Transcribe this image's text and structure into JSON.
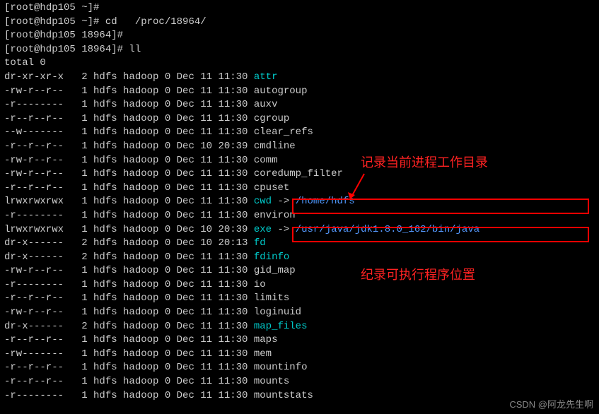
{
  "prompts": [
    {
      "user": "root",
      "host": "hdp105",
      "cwd": "~",
      "cmd_pre": "",
      "cmd": "",
      "tail": ""
    },
    {
      "user": "root",
      "host": "hdp105",
      "cwd": "~",
      "cmd_pre": "cd   ",
      "cmd": "/proc/18964/",
      "tail": ""
    },
    {
      "user": "root",
      "host": "hdp105",
      "cwd": "18964",
      "cmd_pre": "",
      "cmd": "",
      "tail": ""
    },
    {
      "user": "root",
      "host": "hdp105",
      "cwd": "18964",
      "cmd_pre": "ll",
      "cmd": "",
      "tail": ""
    }
  ],
  "total_line": "total 0",
  "rows": [
    {
      "perm": "dr-xr-xr-x",
      "n": "2",
      "u": "hdfs",
      "g": "hadoop",
      "s": "0",
      "mo": "Dec",
      "d": "11",
      "t": "11:30",
      "name": "attr",
      "link": "",
      "color": "cyan"
    },
    {
      "perm": "-rw-r--r--",
      "n": "1",
      "u": "hdfs",
      "g": "hadoop",
      "s": "0",
      "mo": "Dec",
      "d": "11",
      "t": "11:30",
      "name": "autogroup",
      "link": "",
      "color": ""
    },
    {
      "perm": "-r--------",
      "n": "1",
      "u": "hdfs",
      "g": "hadoop",
      "s": "0",
      "mo": "Dec",
      "d": "11",
      "t": "11:30",
      "name": "auxv",
      "link": "",
      "color": ""
    },
    {
      "perm": "-r--r--r--",
      "n": "1",
      "u": "hdfs",
      "g": "hadoop",
      "s": "0",
      "mo": "Dec",
      "d": "11",
      "t": "11:30",
      "name": "cgroup",
      "link": "",
      "color": ""
    },
    {
      "perm": "--w-------",
      "n": "1",
      "u": "hdfs",
      "g": "hadoop",
      "s": "0",
      "mo": "Dec",
      "d": "11",
      "t": "11:30",
      "name": "clear_refs",
      "link": "",
      "color": ""
    },
    {
      "perm": "-r--r--r--",
      "n": "1",
      "u": "hdfs",
      "g": "hadoop",
      "s": "0",
      "mo": "Dec",
      "d": "10",
      "t": "20:39",
      "name": "cmdline",
      "link": "",
      "color": ""
    },
    {
      "perm": "-rw-r--r--",
      "n": "1",
      "u": "hdfs",
      "g": "hadoop",
      "s": "0",
      "mo": "Dec",
      "d": "11",
      "t": "11:30",
      "name": "comm",
      "link": "",
      "color": ""
    },
    {
      "perm": "-rw-r--r--",
      "n": "1",
      "u": "hdfs",
      "g": "hadoop",
      "s": "0",
      "mo": "Dec",
      "d": "11",
      "t": "11:30",
      "name": "coredump_filter",
      "link": "",
      "color": ""
    },
    {
      "perm": "-r--r--r--",
      "n": "1",
      "u": "hdfs",
      "g": "hadoop",
      "s": "0",
      "mo": "Dec",
      "d": "11",
      "t": "11:30",
      "name": "cpuset",
      "link": "",
      "color": ""
    },
    {
      "perm": "lrwxrwxrwx",
      "n": "1",
      "u": "hdfs",
      "g": "hadoop",
      "s": "0",
      "mo": "Dec",
      "d": "11",
      "t": "11:30",
      "name": "cwd",
      "link": "/home/hdfs",
      "color": "cyan"
    },
    {
      "perm": "-r--------",
      "n": "1",
      "u": "hdfs",
      "g": "hadoop",
      "s": "0",
      "mo": "Dec",
      "d": "11",
      "t": "11:30",
      "name": "environ",
      "link": "",
      "color": ""
    },
    {
      "perm": "lrwxrwxrwx",
      "n": "1",
      "u": "hdfs",
      "g": "hadoop",
      "s": "0",
      "mo": "Dec",
      "d": "10",
      "t": "20:39",
      "name": "exe",
      "link": "/usr/java/jdk1.8.0_162/bin/java",
      "color": "cyan"
    },
    {
      "perm": "dr-x------",
      "n": "2",
      "u": "hdfs",
      "g": "hadoop",
      "s": "0",
      "mo": "Dec",
      "d": "10",
      "t": "20:13",
      "name": "fd",
      "link": "",
      "color": "cyan"
    },
    {
      "perm": "dr-x------",
      "n": "2",
      "u": "hdfs",
      "g": "hadoop",
      "s": "0",
      "mo": "Dec",
      "d": "11",
      "t": "11:30",
      "name": "fdinfo",
      "link": "",
      "color": "cyan"
    },
    {
      "perm": "-rw-r--r--",
      "n": "1",
      "u": "hdfs",
      "g": "hadoop",
      "s": "0",
      "mo": "Dec",
      "d": "11",
      "t": "11:30",
      "name": "gid_map",
      "link": "",
      "color": ""
    },
    {
      "perm": "-r--------",
      "n": "1",
      "u": "hdfs",
      "g": "hadoop",
      "s": "0",
      "mo": "Dec",
      "d": "11",
      "t": "11:30",
      "name": "io",
      "link": "",
      "color": ""
    },
    {
      "perm": "-r--r--r--",
      "n": "1",
      "u": "hdfs",
      "g": "hadoop",
      "s": "0",
      "mo": "Dec",
      "d": "11",
      "t": "11:30",
      "name": "limits",
      "link": "",
      "color": ""
    },
    {
      "perm": "-rw-r--r--",
      "n": "1",
      "u": "hdfs",
      "g": "hadoop",
      "s": "0",
      "mo": "Dec",
      "d": "11",
      "t": "11:30",
      "name": "loginuid",
      "link": "",
      "color": ""
    },
    {
      "perm": "dr-x------",
      "n": "2",
      "u": "hdfs",
      "g": "hadoop",
      "s": "0",
      "mo": "Dec",
      "d": "11",
      "t": "11:30",
      "name": "map_files",
      "link": "",
      "color": "cyan"
    },
    {
      "perm": "-r--r--r--",
      "n": "1",
      "u": "hdfs",
      "g": "hadoop",
      "s": "0",
      "mo": "Dec",
      "d": "11",
      "t": "11:30",
      "name": "maps",
      "link": "",
      "color": ""
    },
    {
      "perm": "-rw-------",
      "n": "1",
      "u": "hdfs",
      "g": "hadoop",
      "s": "0",
      "mo": "Dec",
      "d": "11",
      "t": "11:30",
      "name": "mem",
      "link": "",
      "color": ""
    },
    {
      "perm": "-r--r--r--",
      "n": "1",
      "u": "hdfs",
      "g": "hadoop",
      "s": "0",
      "mo": "Dec",
      "d": "11",
      "t": "11:30",
      "name": "mountinfo",
      "link": "",
      "color": ""
    },
    {
      "perm": "-r--r--r--",
      "n": "1",
      "u": "hdfs",
      "g": "hadoop",
      "s": "0",
      "mo": "Dec",
      "d": "11",
      "t": "11:30",
      "name": "mounts",
      "link": "",
      "color": ""
    },
    {
      "perm": "-r--------",
      "n": "1",
      "u": "hdfs",
      "g": "hadoop",
      "s": "0",
      "mo": "Dec",
      "d": "11",
      "t": "11:30",
      "name": "mountstats",
      "link": "",
      "color": ""
    }
  ],
  "annotations": {
    "ann1": "记录当前进程工作目录",
    "ann2": "纪录可执行程序位置"
  },
  "arrow_symbol": " -> ",
  "watermark": "CSDN @阿龙先生啊"
}
